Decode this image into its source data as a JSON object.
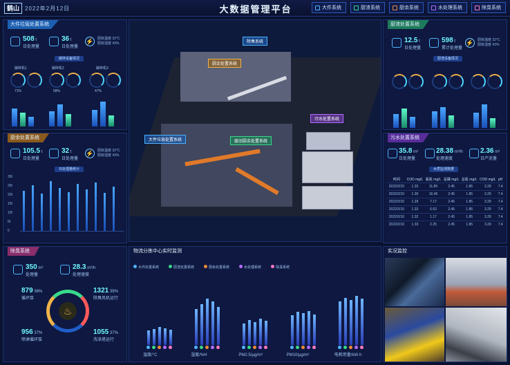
{
  "header": {
    "logo": "鹤山",
    "date": "2022年2月12日",
    "title": "大数据管理平台",
    "nav": [
      {
        "label": "大件系统",
        "color": "#4fb4ff"
      },
      {
        "label": "厨渣系统",
        "color": "#39d98a"
      },
      {
        "label": "厨余系统",
        "color": "#f08a3c"
      },
      {
        "label": "水处理系统",
        "color": "#b46cff"
      },
      {
        "label": "除臭系统",
        "color": "#ff7bc2"
      }
    ]
  },
  "panel_big": {
    "title": "大件垃圾处置系统",
    "v1": "508",
    "v1_unit": "t",
    "v1_label": "日处理量",
    "v2": "36",
    "v2_unit": "t",
    "v2_label": "日处理量",
    "small1": "厨房温度 32°C",
    "small2": "厨房湿度 43%",
    "pill": "破碎设备情况",
    "gauges": [
      {
        "label": "破碎机1",
        "value": "71%"
      },
      {
        "label": "破碎机2",
        "value": "58%"
      },
      {
        "label": "破碎机3",
        "value": "47%"
      }
    ]
  },
  "panel_kitchen": {
    "title": "厨余处置系统",
    "v1": "105.5",
    "v1_unit": "t",
    "v1_label": "日处理量",
    "v2": "32",
    "v2_unit": "t",
    "v2_label": "日处理量",
    "small1": "厨房温度 32°C",
    "small2": "厨房湿度 43%",
    "pill": "日处理量统计",
    "yticks": [
      "30t",
      "25t",
      "20t",
      "15t",
      "10t",
      "5t",
      "0"
    ]
  },
  "panel_odor": {
    "title": "除臭系统",
    "v1": "350",
    "v1_unit": "m³",
    "v1_label": "处理量",
    "v2": "28.3",
    "v2_unit": "m³/h",
    "v2_label": "处理速度",
    "stats": [
      {
        "value": "879",
        "pct": "36%",
        "label": "循环泵"
      },
      {
        "value": "1321",
        "pct": "39%",
        "label": "除臭风机运行"
      },
      {
        "value": "956",
        "pct": "37%",
        "label": "喷淋循环泵"
      },
      {
        "value": "1055",
        "pct": "37%",
        "label": "洗涤塔运行"
      }
    ]
  },
  "panel_waste": {
    "title": "厨渣处置系统",
    "v1": "12.5",
    "v1_unit": "t",
    "v1_label": "日处理量",
    "v2": "598",
    "v2_unit": "t",
    "v2_label": "累计处理量",
    "small1": "厨房温度 32°C",
    "small2": "厨房湿度 43%",
    "pill": "厨渣设备情况"
  },
  "panel_water": {
    "title": "污水处置系统",
    "v1": "35.8",
    "v1_unit": "m³",
    "v1_label": "日处理量",
    "v2": "28.38",
    "v2_unit": "m³/h",
    "v2_label": "处理速度",
    "v3": "2.36",
    "v3_unit": "m³",
    "v3_label": "日产泥量",
    "pill": "水质监测数据",
    "headers": [
      "时间",
      "COD mg/L",
      "氨氮 mg/L",
      "总磷 mg/L",
      "总氮 mg/L",
      "COD mg/L",
      "pH"
    ],
    "rows": [
      [
        "2022/2/10",
        "1.33",
        "11.85",
        "2.45",
        "1.85",
        "3.29",
        "7.4"
      ],
      [
        "2022/2/10",
        "1.30",
        "16.45",
        "2.45",
        "1.85",
        "3.29",
        "7.4"
      ],
      [
        "2022/2/10",
        "1.29",
        "7.17",
        "2.45",
        "1.85",
        "3.29",
        "7.4"
      ],
      [
        "2022/2/10",
        "1.33",
        "6.63",
        "2.45",
        "1.85",
        "3.29",
        "7.4"
      ],
      [
        "2022/2/10",
        "1.32",
        "1.17",
        "2.45",
        "1.85",
        "3.29",
        "7.4"
      ],
      [
        "2022/2/10",
        "1.33",
        "2.25",
        "2.45",
        "1.85",
        "3.29",
        "7.4"
      ]
    ]
  },
  "panel_center": {
    "title": "物流分拣中心实时监测",
    "legend": [
      {
        "label": "大件处置系统",
        "color": "#4fb4ff"
      },
      {
        "label": "厨渣处置系统",
        "color": "#39d98a"
      },
      {
        "label": "厨余处置系统",
        "color": "#f08a3c"
      },
      {
        "label": "水处理系统",
        "color": "#b46cff"
      },
      {
        "label": "除臭系统",
        "color": "#ff7bc2"
      }
    ],
    "groups": [
      {
        "label": "温度/°C",
        "values": [
          22,
          24,
          27,
          25,
          23
        ]
      },
      {
        "label": "湿度/%H",
        "values": [
          55,
          62,
          70,
          66,
          58
        ]
      },
      {
        "label": "PM2.5/μg/m³",
        "values": [
          33,
          38,
          35,
          40,
          37
        ]
      },
      {
        "label": "PM10/μg/m³",
        "values": [
          45,
          50,
          48,
          52,
          46
        ]
      },
      {
        "label": "电耗用量/kW·h",
        "values": [
          66,
          72,
          68,
          75,
          70
        ]
      }
    ]
  },
  "panel_video": {
    "title": "实况监控"
  },
  "map": {
    "labels": [
      {
        "text": "厨余处置系统",
        "color": "#f0b24a"
      },
      {
        "text": "除臭系统",
        "color": "#4fb4ff"
      },
      {
        "text": "污水处置系统",
        "color": "#b46cff"
      },
      {
        "text": "大件垃圾处置系统",
        "color": "#4fb4ff"
      },
      {
        "text": "废旧厨余处置系统",
        "color": "#39d98a"
      }
    ]
  }
}
